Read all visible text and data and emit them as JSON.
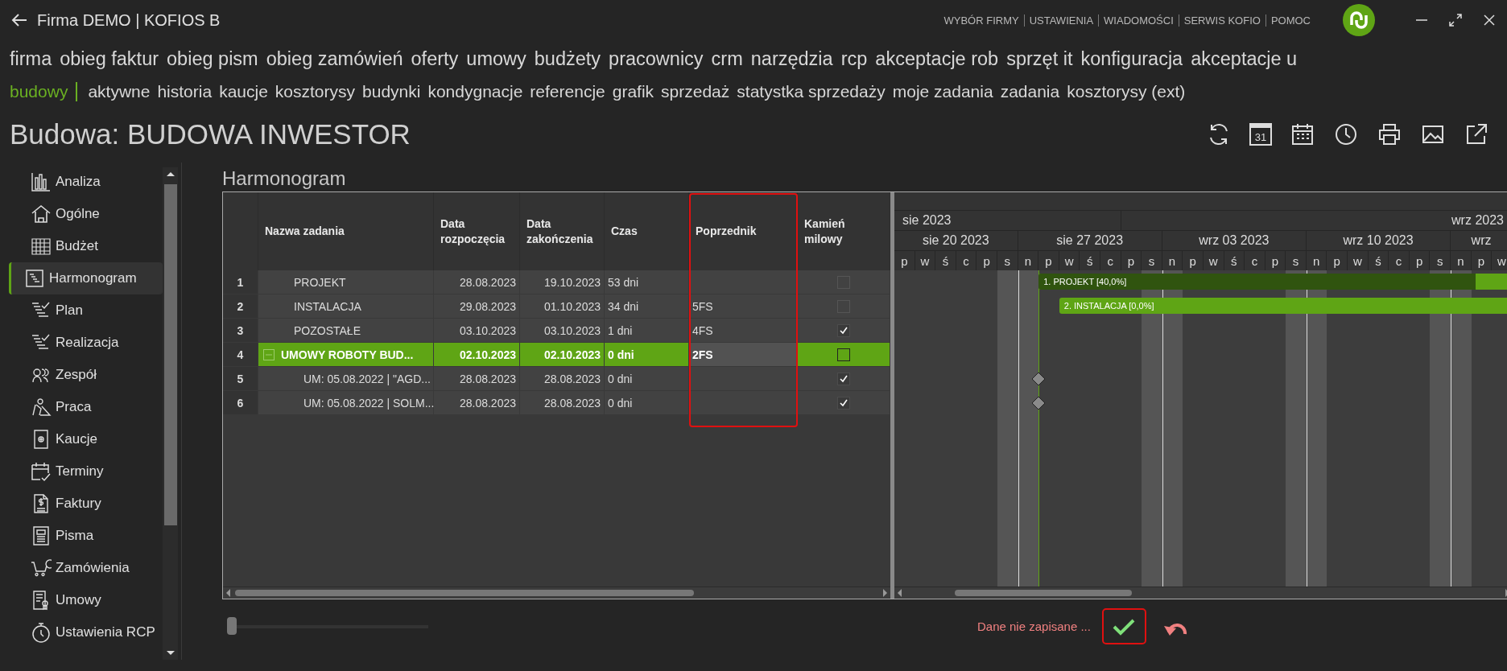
{
  "window": {
    "title": "Firma DEMO | KOFIOS B",
    "links": [
      "WYBÓR FIRMY",
      "USTAWIENIA",
      "WIADOMOŚCI",
      "SERWIS KOFIO",
      "POMOC"
    ]
  },
  "nav": [
    {
      "label": "firma",
      "selected": false
    },
    {
      "label": "obieg faktur",
      "selected": false
    },
    {
      "label": "obieg pism",
      "selected": false
    },
    {
      "label": "obieg zamówień",
      "selected": false
    },
    {
      "label": "oferty",
      "selected": false
    },
    {
      "label": "umowy",
      "selected": false
    },
    {
      "label": "budżety",
      "selected": false
    },
    {
      "label": "pracownicy",
      "selected": false
    },
    {
      "label": "crm",
      "selected": false
    },
    {
      "label": "narzędzia",
      "selected": false
    },
    {
      "label": "rcp",
      "selected": false
    },
    {
      "label": "akceptacje rob",
      "selected": false
    },
    {
      "label": "sprzęt it",
      "selected": false
    },
    {
      "label": "konfiguracja",
      "selected": false
    },
    {
      "label": "akceptacje u",
      "selected": false
    }
  ],
  "subnav": [
    {
      "label": "budowy",
      "selected": true
    },
    {
      "label": "aktywne",
      "selected": false
    },
    {
      "label": "historia",
      "selected": false
    },
    {
      "label": "kaucje",
      "selected": false
    },
    {
      "label": "kosztorysy",
      "selected": false
    },
    {
      "label": "budynki",
      "selected": false
    },
    {
      "label": "kondygnacje",
      "selected": false
    },
    {
      "label": "referencje",
      "selected": false
    },
    {
      "label": "grafik",
      "selected": false
    },
    {
      "label": "sprzedaż",
      "selected": false
    },
    {
      "label": "statystka sprzedaży",
      "selected": false
    },
    {
      "label": "moje zadania",
      "selected": false
    },
    {
      "label": "zadania",
      "selected": false
    },
    {
      "label": "kosztorysy (ext)",
      "selected": false
    }
  ],
  "page_title": "Budowa: BUDOWA INWESTOR",
  "toolbar": {
    "calendar_day": "31"
  },
  "sidebar": {
    "items": [
      {
        "label": "Analiza",
        "selected": false
      },
      {
        "label": "Ogólne",
        "selected": false
      },
      {
        "label": "Budżet",
        "selected": false
      },
      {
        "label": "Harmonogram",
        "selected": true
      },
      {
        "label": "Plan",
        "selected": false
      },
      {
        "label": "Realizacja",
        "selected": false
      },
      {
        "label": "Zespół",
        "selected": false
      },
      {
        "label": "Praca",
        "selected": false
      },
      {
        "label": "Kaucje",
        "selected": false
      },
      {
        "label": "Terminy",
        "selected": false
      },
      {
        "label": "Faktury",
        "selected": false
      },
      {
        "label": "Pisma",
        "selected": false
      },
      {
        "label": "Zamówienia",
        "selected": false
      },
      {
        "label": "Umowy",
        "selected": false
      },
      {
        "label": "Ustawienia RCP",
        "selected": false
      }
    ]
  },
  "section_title": "Harmonogram",
  "table": {
    "columns": [
      {
        "highlighted": false
      },
      {
        "label": "Nazwa zadania",
        "highlighted": false
      },
      {
        "label": "Data rozpoczęcia",
        "highlighted": false
      },
      {
        "label": "Data zakończenia",
        "highlighted": false
      },
      {
        "label": "Czas",
        "highlighted": false
      },
      {
        "label": "Poprzednik",
        "highlighted": true
      },
      {
        "label": "Kamień milowy",
        "highlighted": false
      }
    ],
    "rows": [
      {
        "num": "1",
        "name": "PROJEKT",
        "start": "28.08.2023",
        "end": "19.10.2023",
        "duration": "53 dni",
        "milestone": false,
        "selected": false,
        "bar_label": "1. PROJEKT [40,0%]",
        "level": 0.4
      },
      {
        "num": "2",
        "name": "INSTALACJA",
        "start": "29.08.2023",
        "end": "01.10.2023",
        "duration": "34 dni",
        "predecessor": "5FS",
        "milestone": false,
        "selected": false,
        "bar_label": "2. INSTALACJA [0,0%]",
        "level": 0
      },
      {
        "num": "3",
        "name": "POZOSTAŁE",
        "start": "03.10.2023",
        "end": "03.10.2023",
        "duration": "1 dni",
        "predecessor": "4FS",
        "milestone": true,
        "selected": false
      },
      {
        "num": "4",
        "name": "UMOWY ROBOTY BUD...",
        "start": "02.10.2023",
        "end": "02.10.2023",
        "duration": "0 dni",
        "predecessor": "2FS",
        "milestone": false,
        "selected": true,
        "expanded": true,
        "children": [
          {
            "num": "5",
            "name": "UM: 05.08.2022 | \"AGD...",
            "start": "28.08.2023",
            "end": "28.08.2023",
            "duration": "0 dni",
            "milestone": true,
            "selected": false
          },
          {
            "num": "6",
            "name": "UM: 05.08.2022 | SOLM...",
            "start": "28.08.2023",
            "end": "28.08.2023",
            "duration": "0 dni",
            "milestone": true,
            "selected": false
          }
        ]
      }
    ]
  },
  "gantt": {
    "months": [
      "sie 2023",
      "wrz 2023"
    ],
    "weeks": [
      "sie 20 2023",
      "sie 27 2023",
      "wrz 03 2023",
      "wrz 10 2023",
      "wrz"
    ],
    "days": [
      {
        "label": "p",
        "weekend": false
      },
      {
        "label": "w",
        "weekend": false
      },
      {
        "label": "ś",
        "weekend": false
      },
      {
        "label": "c",
        "weekend": false
      },
      {
        "label": "p",
        "weekend": false
      },
      {
        "label": "s",
        "weekend": true
      },
      {
        "label": "n",
        "weekend": true
      },
      {
        "label": "p",
        "weekend": false
      },
      {
        "label": "w",
        "weekend": false
      },
      {
        "label": "ś",
        "weekend": false
      },
      {
        "label": "c",
        "weekend": false
      },
      {
        "label": "p",
        "weekend": false
      },
      {
        "label": "s",
        "weekend": true
      },
      {
        "label": "n",
        "weekend": true
      },
      {
        "label": "p",
        "weekend": false
      },
      {
        "label": "w",
        "weekend": false
      },
      {
        "label": "ś",
        "weekend": false
      },
      {
        "label": "c",
        "weekend": false
      },
      {
        "label": "p",
        "weekend": false
      },
      {
        "label": "s",
        "weekend": true
      },
      {
        "label": "n",
        "weekend": true
      },
      {
        "label": "p",
        "weekend": false
      },
      {
        "label": "w",
        "weekend": false
      },
      {
        "label": "ś",
        "weekend": false
      },
      {
        "label": "c",
        "weekend": false
      },
      {
        "label": "p",
        "weekend": false
      },
      {
        "label": "s",
        "weekend": true
      },
      {
        "label": "n",
        "weekend": true
      },
      {
        "label": "p",
        "weekend": false
      },
      {
        "label": "w",
        "weekend": false
      }
    ]
  },
  "zoom": {
    "level": 0
  },
  "status": "Dane nie zapisane ..."
}
